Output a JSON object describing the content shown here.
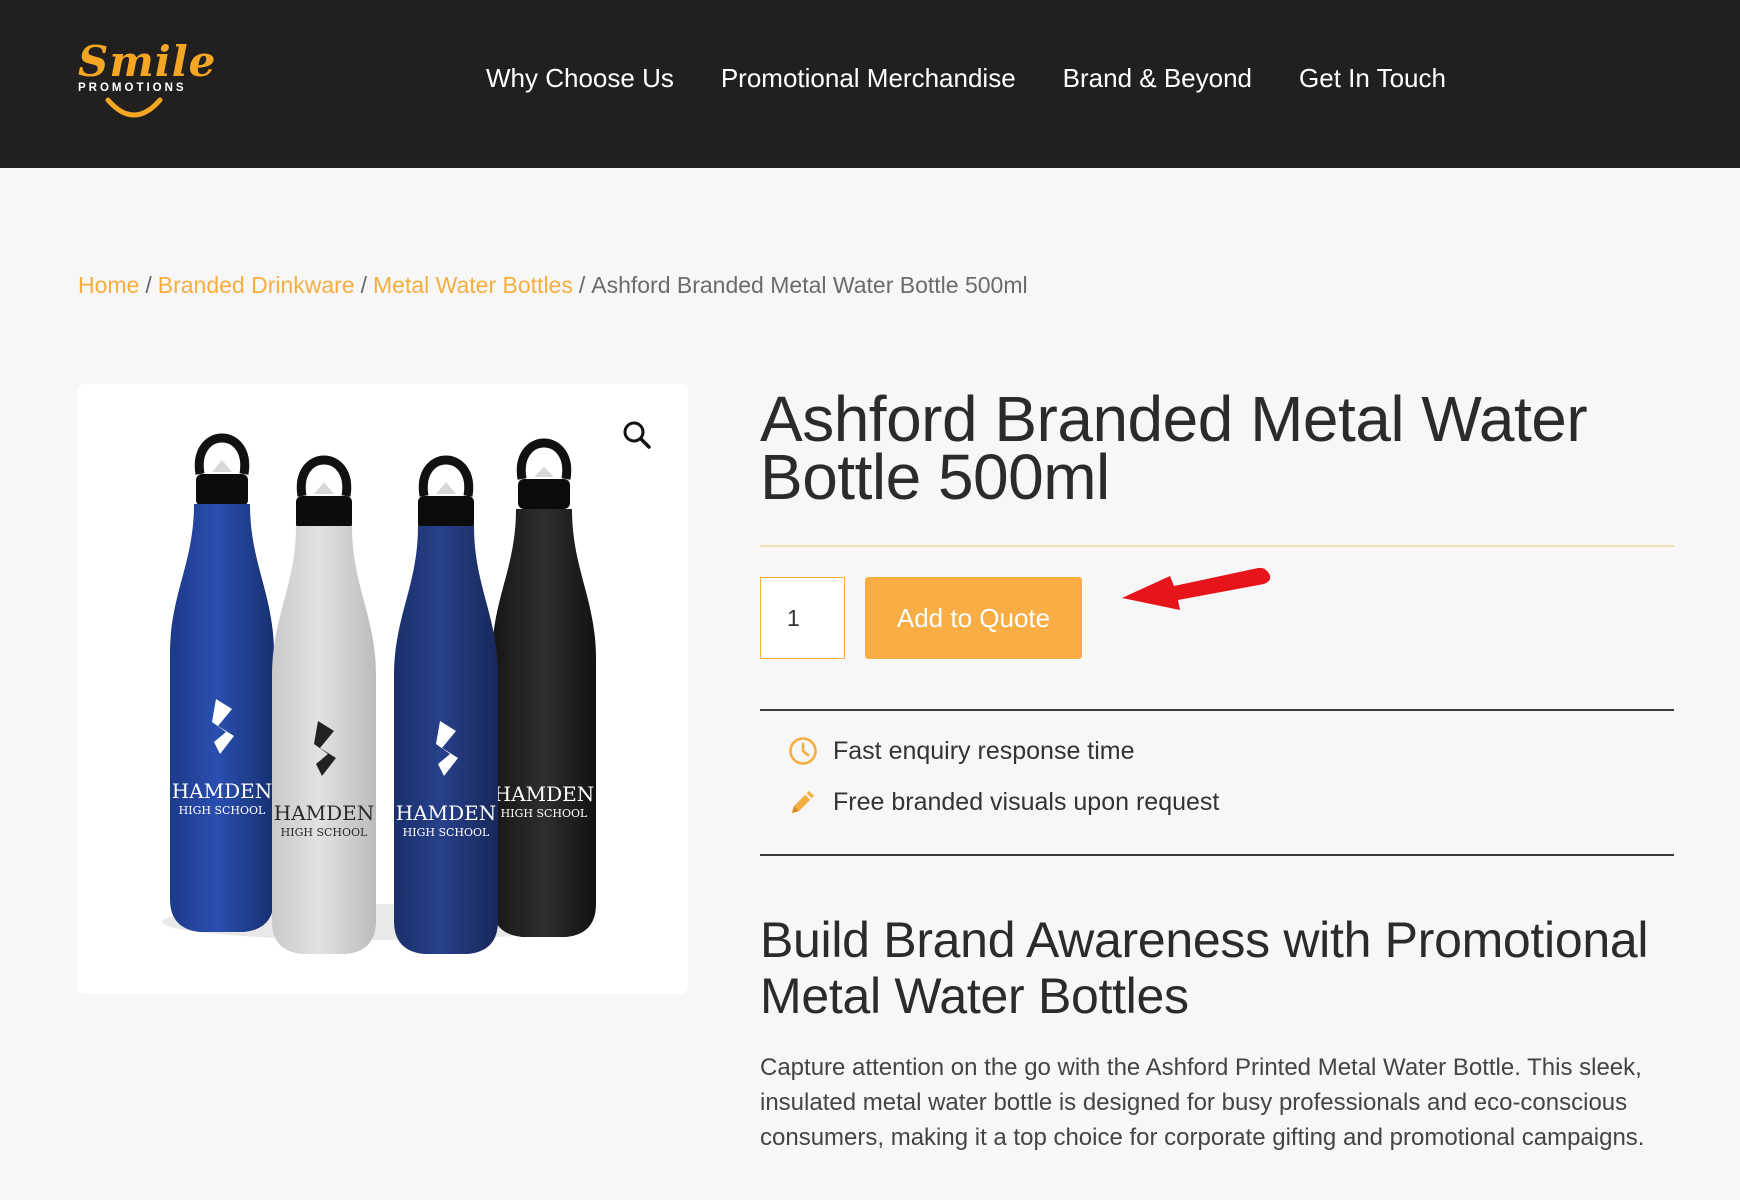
{
  "brand": {
    "logo_script": "Smile",
    "logo_sub": "PROMOTIONS",
    "accent_color": "#f5a623",
    "header_bg": "#221f1f"
  },
  "nav": {
    "items": [
      {
        "label": "Why Choose Us"
      },
      {
        "label": "Promotional Merchandise"
      },
      {
        "label": "Brand & Beyond"
      },
      {
        "label": "Get In Touch"
      }
    ]
  },
  "breadcrumb": {
    "items": [
      {
        "label": "Home"
      },
      {
        "label": "Branded Drinkware"
      },
      {
        "label": "Metal Water Bottles"
      }
    ],
    "separator": "/",
    "current": "Ashford Branded Metal Water Bottle 500ml"
  },
  "product": {
    "title": "Ashford Branded Metal Water Bottle 500ml",
    "quantity": "1",
    "add_button_label": "Add to Quote",
    "button_color": "#f8ad45",
    "image_icon": "zoom-icon",
    "bottle_print": {
      "brand": "HAMDEN",
      "sub": "HIGH SCHOOL"
    },
    "features": [
      {
        "icon": "clock-icon",
        "text": "Fast enquiry response time"
      },
      {
        "icon": "pencil-icon",
        "text": "Free branded visuals upon request"
      }
    ]
  },
  "content": {
    "heading": "Build Brand Awareness with Promotional Metal Water Bottles",
    "description": "Capture attention on the go with the Ashford Printed Metal Water Bottle. This sleek, insulated metal water bottle is designed for busy professionals and eco-conscious consumers, making it a top choice for corporate gifting and promotional campaigns."
  },
  "annotation": {
    "arrow_color": "#e8141b"
  }
}
